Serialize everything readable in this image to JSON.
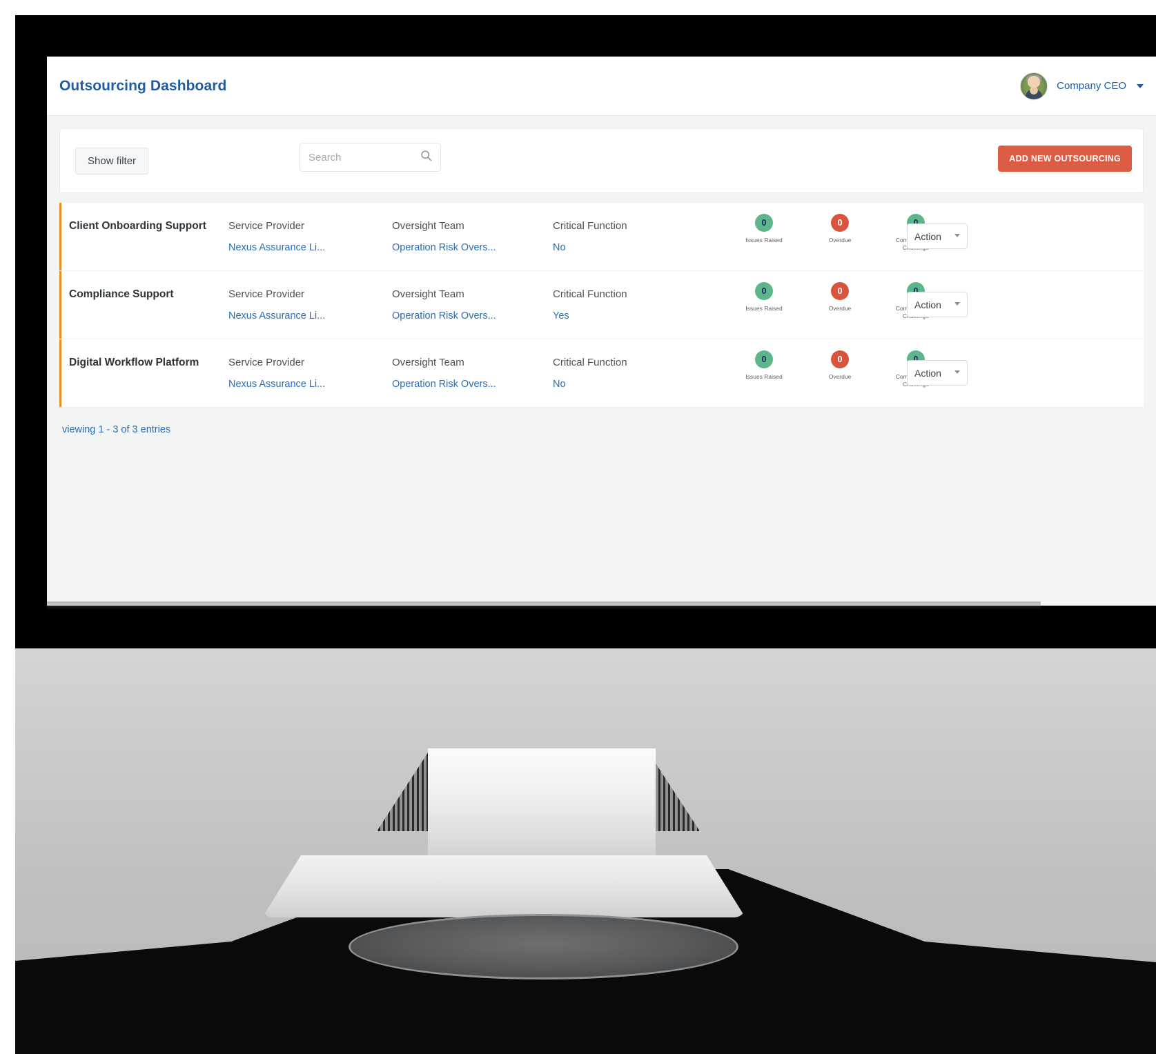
{
  "header": {
    "title": "Outsourcing Dashboard",
    "user_name": "Company CEO",
    "avatar_icon": "user-avatar-photo",
    "caret_icon": "chevron-down-icon"
  },
  "toolbar": {
    "show_filter_label": "Show filter",
    "search_placeholder": "Search",
    "search_value": "",
    "search_icon": "search-icon",
    "add_button_label": "ADD NEW OUTSOURCING"
  },
  "columns": {
    "service_provider": "Service Provider",
    "oversight_team": "Oversight Team",
    "critical_function": "Critical Function"
  },
  "stat_labels": {
    "issues_raised": "Issues Raised",
    "overdue": "Overdue",
    "completed_with_challenge": "Completed with Challenge"
  },
  "action": {
    "label": "Action",
    "options": [
      "Action"
    ],
    "caret_icon": "chevron-down-icon"
  },
  "rows": [
    {
      "name": "Client Onboarding Support",
      "service_provider_label": "Service Provider",
      "service_provider": "Nexus Assurance Li...",
      "oversight_team_label": "Oversight Team",
      "oversight_team": "Operation Risk Overs...",
      "critical_function_label": "Critical Function",
      "critical_function": "No",
      "issues_raised": "0",
      "overdue": "0",
      "completed_with_challenge": "0"
    },
    {
      "name": "Compliance Support",
      "service_provider_label": "Service Provider",
      "service_provider": "Nexus Assurance Li...",
      "oversight_team_label": "Oversight Team",
      "oversight_team": "Operation Risk Overs...",
      "critical_function_label": "Critical Function",
      "critical_function": "Yes",
      "issues_raised": "0",
      "overdue": "0",
      "completed_with_challenge": "0"
    },
    {
      "name": "Digital Workflow Platform",
      "service_provider_label": "Service Provider",
      "service_provider": "Nexus Assurance Li...",
      "oversight_team_label": "Oversight Team",
      "oversight_team": "Operation Risk Overs...",
      "critical_function_label": "Critical Function",
      "critical_function": "No",
      "issues_raised": "0",
      "overdue": "0",
      "completed_with_challenge": "0"
    }
  ],
  "footer": {
    "entries_text": "viewing 1 - 3 of 3 entries"
  },
  "colors": {
    "brand_blue": "#1f5c9e",
    "link_blue": "#2a6db5",
    "accent_orange": "#e8911f",
    "add_button_red": "#dd5c44",
    "badge_green": "#5cb58b",
    "badge_red": "#d9543c",
    "page_bg": "#f3f4f4"
  }
}
